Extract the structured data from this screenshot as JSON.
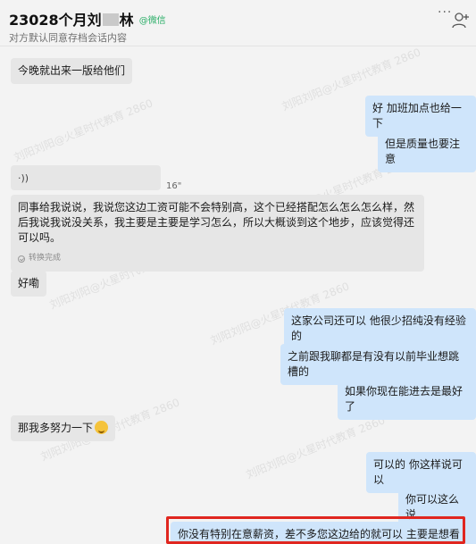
{
  "header": {
    "title_prefix": "23028个月刘",
    "title_suffix": "林",
    "source_tag": "@微信",
    "subtitle": "对方默认同意存档会话内容",
    "more_label": "···"
  },
  "messages": [
    {
      "side": "left",
      "text": "今晚就出来一版给他们"
    },
    {
      "side": "right",
      "text": "好 加班加点也给一下"
    },
    {
      "side": "right",
      "text": "但是质量也要注意"
    },
    {
      "side": "left",
      "type": "voice",
      "duration": "16\"",
      "transcript": "同事给我说说，我说您这边工资可能不会特别高，这个已经搭配怎么怎么怎么样，然后我说我说没关系，我主要是主要是学习怎么，所以大概谈到这个地步，应该觉得还可以吗。",
      "status": "转换完成"
    },
    {
      "side": "left",
      "text": "好嘞"
    },
    {
      "side": "right",
      "text": "这家公司还可以  他很少招纯没有经验的"
    },
    {
      "side": "right",
      "text": "之前跟我聊都是有没有以前毕业想跳槽的"
    },
    {
      "side": "right",
      "text": "如果你现在能进去是最好了"
    },
    {
      "side": "left",
      "text": "那我多努力一下"
    },
    {
      "side": "right",
      "text": "可以的 你这样说可以"
    },
    {
      "side": "right",
      "text": "你可以这么说"
    },
    {
      "side": "right",
      "text": "你没有特别在意薪资，差不多您这边给的就可以  主要是想看中项目"
    }
  ],
  "watermark": "刘阳刘阳@火星时代教育 2860",
  "colors": {
    "left_bubble": "#e6e6e6",
    "right_bubble": "#cfe5fb",
    "highlight": "#e0261f",
    "wechat_green": "#2aae67"
  }
}
